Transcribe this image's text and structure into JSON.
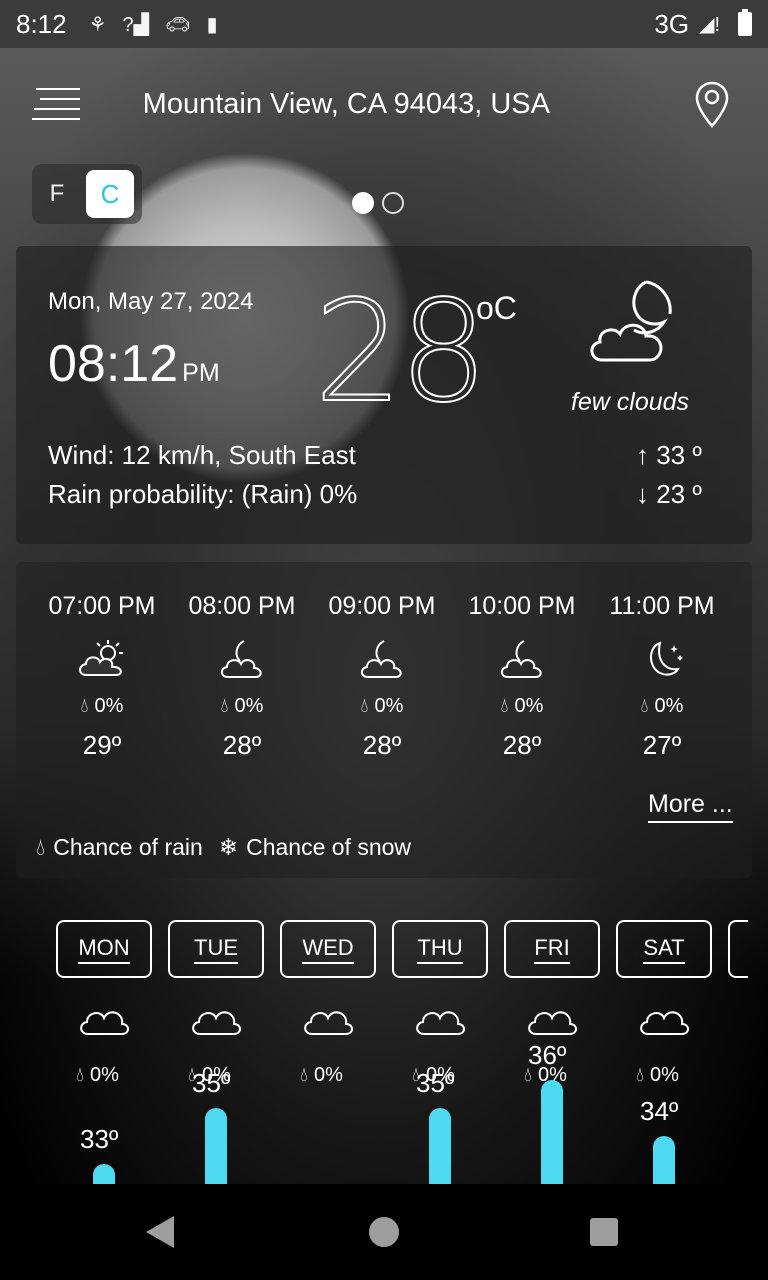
{
  "status_bar": {
    "time": "8:12",
    "network": "3G"
  },
  "header": {
    "location": "Mountain View, CA 94043, USA"
  },
  "units": {
    "f": "F",
    "c": "C",
    "selected": "C"
  },
  "current": {
    "date": "Mon, May 27, 2024",
    "time": "08:12",
    "ampm": "PM",
    "temp": "28",
    "unit": "oC",
    "condition": "few clouds",
    "wind": "Wind: 12 km/h, South East",
    "rain": "Rain probability: (Rain) 0%",
    "high": "↑ 33 º",
    "low": "↓ 23 º"
  },
  "hourly": [
    {
      "time": "07:00 PM",
      "icon": "sun-cloud-icon",
      "rain": "0%",
      "temp": "29º"
    },
    {
      "time": "08:00 PM",
      "icon": "moon-cloud-icon",
      "rain": "0%",
      "temp": "28º"
    },
    {
      "time": "09:00 PM",
      "icon": "moon-cloud-icon",
      "rain": "0%",
      "temp": "28º"
    },
    {
      "time": "10:00 PM",
      "icon": "moon-cloud-icon",
      "rain": "0%",
      "temp": "28º"
    },
    {
      "time": "11:00 PM",
      "icon": "moon-stars-icon",
      "rain": "0%",
      "temp": "27º"
    }
  ],
  "more_label": "More ...",
  "legend": {
    "rain": "Chance of rain",
    "snow": "Chance of snow"
  },
  "daily": [
    {
      "day": "MON",
      "rain": "0%",
      "temp": "33º",
      "high": 33
    },
    {
      "day": "TUE",
      "rain": "0%",
      "temp": "35º",
      "high": 35
    },
    {
      "day": "WED",
      "rain": "0%",
      "temp": "",
      "high": null
    },
    {
      "day": "THU",
      "rain": "0%",
      "temp": "35º",
      "high": 35
    },
    {
      "day": "FRI",
      "rain": "0%",
      "temp": "36º",
      "high": 36
    },
    {
      "day": "SAT",
      "rain": "0%",
      "temp": "34º",
      "high": 34
    }
  ],
  "colors": {
    "accent": "#26c6da",
    "bar": "#4dd9f0"
  }
}
